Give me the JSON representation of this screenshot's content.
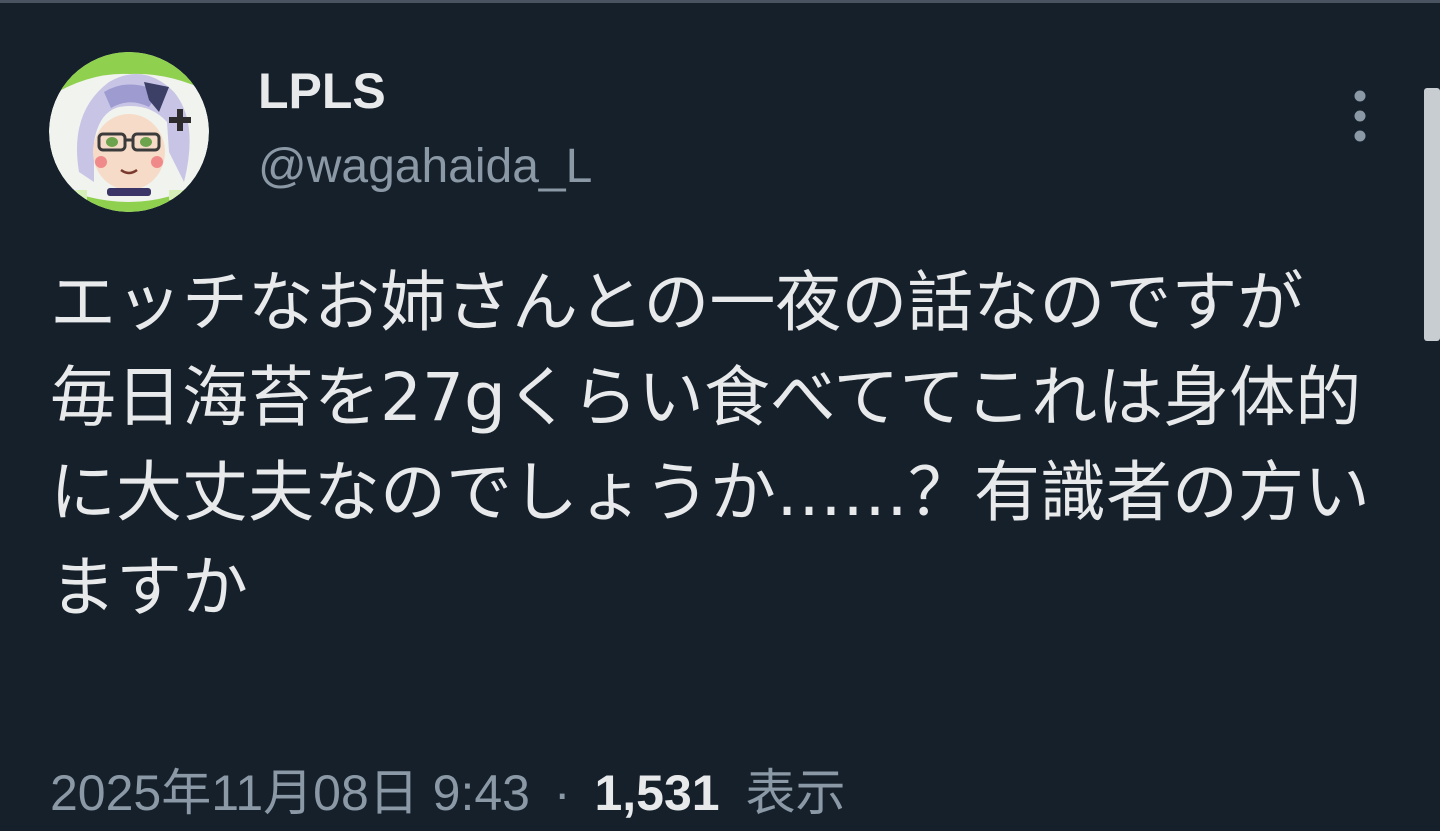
{
  "tweet": {
    "author": {
      "display_name": "LPLS",
      "handle": "@wagahaida_L",
      "avatar_icon": "anime-character-avatar"
    },
    "text": "エッチなお姉さんとの一夜の話なのですが\n毎日海苔を27gくらい食べててこれは身体的に大丈夫なのでしょうか……？有識者の方いますか",
    "timestamp": "2025年11月08日 9:43",
    "separator": "·",
    "views_count": "1,531",
    "views_label": "表示",
    "more_icon": "more-vertical-icon"
  },
  "colors": {
    "background": "#15202b",
    "primary_text": "#e7e9ea",
    "secondary_text": "#8b98a5"
  }
}
